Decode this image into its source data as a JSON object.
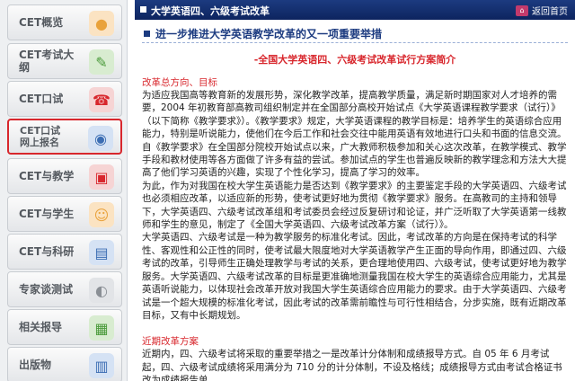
{
  "sidebar": {
    "items": [
      {
        "label": "CET概览",
        "icon": "cet-overview-icon",
        "color": "#e9a23b"
      },
      {
        "label": "CET考试大纲",
        "icon": "syllabus-icon",
        "color": "#4a9a3a"
      },
      {
        "label": "CET口试",
        "icon": "oral-test-icon",
        "color": "#d8272d"
      },
      {
        "label": "CET口试\n网上报名",
        "icon": "online-register-icon",
        "color": "#3b6db3"
      },
      {
        "label": "CET与教学",
        "icon": "teaching-icon",
        "color": "#d8272d"
      },
      {
        "label": "CET与学生",
        "icon": "students-icon",
        "color": "#e9a23b"
      },
      {
        "label": "CET与科研",
        "icon": "research-icon",
        "color": "#3b6db3"
      },
      {
        "label": "专家谈测试",
        "icon": "expert-icon",
        "color": "#8a8f95"
      },
      {
        "label": "相关报导",
        "icon": "report-icon",
        "color": "#4a9a3a"
      },
      {
        "label": "出版物",
        "icon": "publication-icon",
        "color": "#3b6db3"
      }
    ]
  },
  "header": {
    "title": "大学英语四、六级考试改革",
    "home_label": "返回首页"
  },
  "article": {
    "title": "进一步推进大学英语教学改革的又一项重要举措",
    "subtitle": "-全国大学英语四、六级考试改革试行方案简介",
    "section1": "改革总方向、目标",
    "p1": "为适应我国高等教育新的发展形势，深化教学改革，提高教学质量，满足新时期国家对人才培养的需要，2004 年初教育部高教司组织制定并在全国部分高校开始试点《大学英语课程教学要求（试行）》（以下简称《教学要求》）。《教学要求》规定，大学英语课程的教学目标是：培养学生的英语综合应用能力，特别是听说能力，使他们在今后工作和社会交往中能用英语有效地进行口头和书面的信息交流。自《教学要求》在全国部分院校开始试点以来，广大教师积极参加和关心这次改革，在教学模式、教学手段和教材使用等各方面做了许多有益的尝试。参加试点的学生也普遍反映新的教学理念和方法大大提高了他们学习英语的兴趣，实现了个性化学习，提高了学习的效率。",
    "p2": "为此，作为对我国在校大学生英语能力是否达到《教学要求》的主要鉴定手段的大学英语四、六级考试也必须相应改革，以适应新的形势，使考试更好地为贯彻《教学要求》服务。在高教司的主持和领导下，大学英语四、六级考试改革组和考试委员会经过反复研讨和论证，并广泛听取了大学英语第一线教师和学生的意见，制定了《全国大学英语四、六级考试改革方案（试行）》。",
    "p3": "大学英语四、六级考试是一种为教学服务的标准化考试。因此，考试改革的方向是在保持考试的科学性、客观性和公正性的同时，使考试最大限度地对大学英语教学产生正面的导向作用，即通过四、六级考试的改革，引导师生正确处理教学与考试的关系，更合理地使用四、六级考试，使考试更好地为教学服务。大学英语四、六级考试改革的目标是更准确地测量我国在校大学生的英语综合应用能力，尤其是英语听说能力，以体现社会改革开放对我国大学生英语综合应用能力的要求。由于大学英语四、六级考试是一个超大规模的标准化考试，因此考试的改革需前瞻性与可行性相结合，分步实施，既有近期改革目标，又有中长期规划。",
    "section2": "近期改革方案",
    "p4": "近期内，四、六级考试将采取的重要举措之一是改革计分体制和成绩报导方式。自 05 年 6 月考试起，四、六级考试成绩将采用满分为 710 分的计分体制，不设及格线；成绩报导方式由考试合格证书改为成绩报告单"
  }
}
